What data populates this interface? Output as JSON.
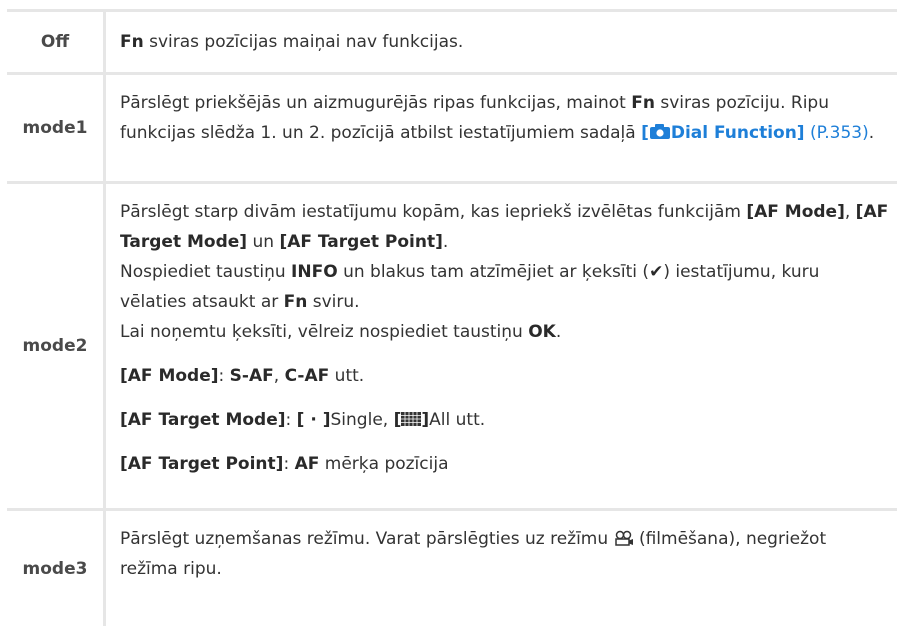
{
  "rows": [
    {
      "label": "Off",
      "fn": "Fn",
      "text": " sviras pozīcijas maiņai nav funkcijas."
    },
    {
      "label": "mode1",
      "t1": "Pārslēgt priekšējās un aizmugurējās ripas funkcijas, mainot ",
      "fn": "Fn",
      "t2": " sviras pozīciju. Ripu funkcijas slēdža 1. un 2. pozīcijā atbilst iestatījumiem sadaļā ",
      "link_open": "[",
      "link_text": "Dial Function]",
      "page_ref": "(P.353)",
      "end": "."
    },
    {
      "label": "mode2",
      "p1_a": "Pārslēgt starp divām iestatījumu kopām, kas iepriekš izvēlētas funkcijām ",
      "p1_b": "[AF Mode]",
      "p1_c": ", ",
      "p1_d": "[AF Target Mode]",
      "p1_e": " un ",
      "p1_f": "[AF Target Point]",
      "p1_g": ".",
      "p2_a": "Nospiediet taustiņu ",
      "p2_b": "INFO",
      "p2_c": " un blakus tam atzīmējiet ar ķeksīti (",
      "p2_check": "✔",
      "p2_d": ") iestatījumu, kuru vēlaties atsaukt ar ",
      "p2_e": "Fn",
      "p2_f": " sviru.",
      "p3_a": "Lai noņemtu ķeksīti, vēlreiz nospiediet taustiņu ",
      "p3_b": "OK",
      "p3_c": ".",
      "l1_a": "[AF Mode]",
      "l1_b": ": ",
      "l1_c": "S-AF",
      "l1_d": ", ",
      "l1_e": "C-AF",
      "l1_f": " utt.",
      "l2_a": "[AF Target Mode]",
      "l2_b": ": ",
      "l2_c": "[ · ]",
      "l2_d": "Single, ",
      "l2_e": "[",
      "l2_f": "]",
      "l2_g": "All utt.",
      "l3_a": "[AF Target Point]",
      "l3_b": ": ",
      "l3_c": "AF",
      "l3_d": " mērķa pozīcija"
    },
    {
      "label": "mode3",
      "t1": "Pārslēgt uzņemšanas režīmu. Varat pārslēgties uz režīmu ",
      "t2": " (filmēšana), negriežot režīma ripu."
    }
  ]
}
